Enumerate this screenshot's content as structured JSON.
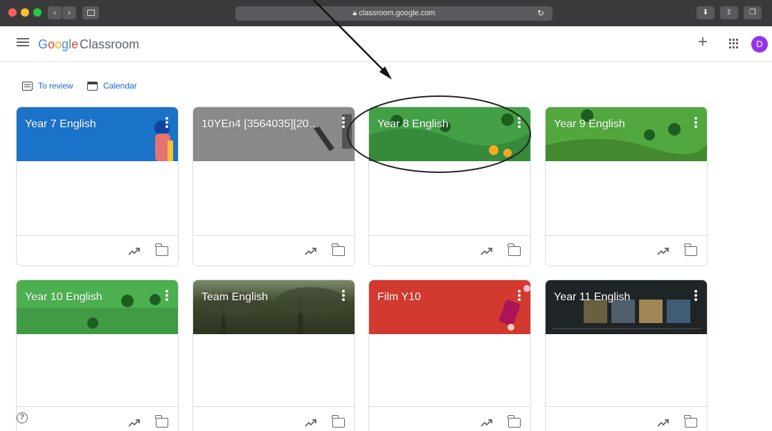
{
  "browser": {
    "url": "classroom.google.com"
  },
  "header": {
    "brand_google": "Google",
    "brand_product": "Classroom",
    "avatar_letter": "D"
  },
  "quick_links": {
    "to_review": "To review",
    "calendar": "Calendar"
  },
  "classes": [
    {
      "name": "Year 7 English",
      "banner": "blue"
    },
    {
      "name": "10YEn4 [3564035][20…",
      "banner": "grey"
    },
    {
      "name": "Year 8 English",
      "banner": "green"
    },
    {
      "name": "Year 9 English",
      "banner": "green"
    },
    {
      "name": "Year 10 English",
      "banner": "green"
    },
    {
      "name": "Team English",
      "banner": "trees"
    },
    {
      "name": "Film Y10",
      "banner": "red"
    },
    {
      "name": "Year 11 English",
      "banner": "dark"
    }
  ],
  "colors": {
    "accent_blue": "#1967d2",
    "avatar": "#9334e6",
    "year7_banner": "#1a73c8",
    "film_banner": "#d23a2f"
  },
  "icons": [
    "menu-icon",
    "plus-icon",
    "apps-grid-icon",
    "trending-icon",
    "folder-icon",
    "help-icon",
    "more-vert-icon"
  ]
}
